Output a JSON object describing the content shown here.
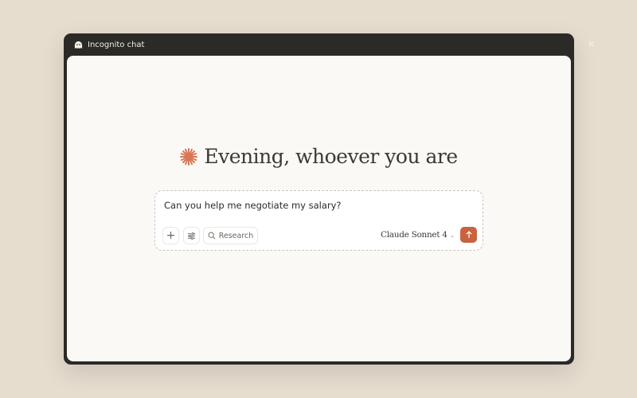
{
  "window": {
    "title": "Incognito chat",
    "title_icon": "ghost-icon",
    "close_icon": "close-icon"
  },
  "greeting": {
    "text": "Evening, whoever you are",
    "icon": "sparkle-icon",
    "accent": "#d97757"
  },
  "composer": {
    "value": "Can you help me negotiate my salary?",
    "research_label": "Research",
    "model": "Claude Sonnet 4",
    "send_color": "#c9623f"
  }
}
